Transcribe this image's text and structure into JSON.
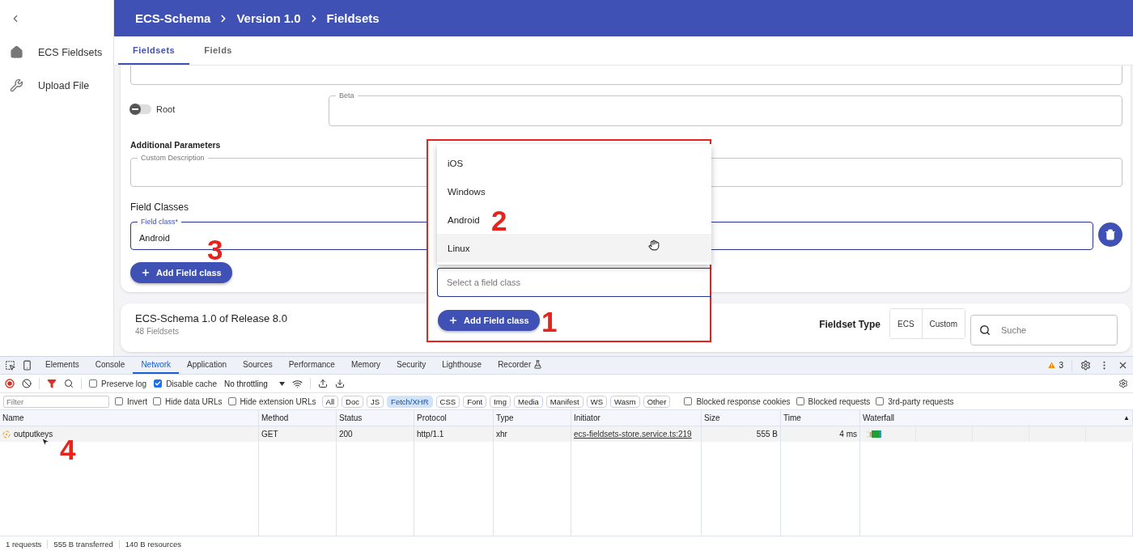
{
  "sidebar": {
    "items": [
      {
        "label": "ECS Fieldsets"
      },
      {
        "label": "Upload File"
      }
    ]
  },
  "breadcrumb": [
    "ECS-Schema",
    "Version 1.0",
    "Fieldsets"
  ],
  "tabs": [
    {
      "label": "Fieldsets",
      "selected": true
    },
    {
      "label": "Fields",
      "selected": false
    }
  ],
  "form": {
    "root_toggle": {
      "label": "Root",
      "on": false
    },
    "beta_field": {
      "label": "Beta"
    },
    "additional_parameters": "Additional Parameters",
    "custom_description": {
      "label": "Custom Description"
    },
    "field_classes_heading": "Field Classes",
    "field_class": {
      "label": "Field class*",
      "value": "Android"
    },
    "add_button": "Add Field class"
  },
  "fieldsets_card": {
    "title": "ECS-Schema 1.0 of Release 8.0",
    "count": "48 Fieldsets",
    "type_label": "Fieldset Type",
    "type_options": [
      {
        "label": "ECS",
        "selected": false
      },
      {
        "label": "Custom",
        "selected": false
      }
    ],
    "search": {
      "placeholder": "Suche"
    }
  },
  "overlay": {
    "options": [
      {
        "label": "iOS",
        "hovered": false
      },
      {
        "label": "Windows",
        "hovered": false
      },
      {
        "label": "Android",
        "hovered": false
      },
      {
        "label": "Linux",
        "hovered": true
      }
    ],
    "field": {
      "placeholder": "Select a field class"
    },
    "add_button": "Add Field class"
  },
  "annotations": [
    "1",
    "2",
    "3",
    "4"
  ],
  "devtools": {
    "panel_tabs": [
      {
        "label": "Elements",
        "selected": false
      },
      {
        "label": "Console",
        "selected": false
      },
      {
        "label": "Network",
        "selected": true
      },
      {
        "label": "Application",
        "selected": false
      },
      {
        "label": "Sources",
        "selected": false
      },
      {
        "label": "Performance",
        "selected": false
      },
      {
        "label": "Memory",
        "selected": false
      },
      {
        "label": "Security",
        "selected": false
      },
      {
        "label": "Lighthouse",
        "selected": false
      },
      {
        "label": "Recorder",
        "selected": false
      }
    ],
    "warnings": "3",
    "toolbar": {
      "checkboxes": [
        {
          "label": "Preserve log",
          "checked": false
        },
        {
          "label": "Disable cache",
          "checked": true
        }
      ],
      "throttling": "No throttling"
    },
    "filter": {
      "placeholder": "Filter",
      "checkboxes": [
        {
          "label": "Invert",
          "checked": false
        },
        {
          "label": "Hide data URLs",
          "checked": false
        },
        {
          "label": "Hide extension URLs",
          "checked": false
        }
      ],
      "types": [
        {
          "label": "All",
          "selected": false
        },
        {
          "label": "Doc",
          "selected": false
        },
        {
          "label": "JS",
          "selected": false
        },
        {
          "label": "Fetch/XHR",
          "selected": true
        },
        {
          "label": "CSS",
          "selected": false
        },
        {
          "label": "Font",
          "selected": false
        },
        {
          "label": "Img",
          "selected": false
        },
        {
          "label": "Media",
          "selected": false
        },
        {
          "label": "Manifest",
          "selected": false
        },
        {
          "label": "WS",
          "selected": false
        },
        {
          "label": "Wasm",
          "selected": false
        },
        {
          "label": "Other",
          "selected": false
        }
      ],
      "more_checkboxes": [
        {
          "label": "Blocked response cookies",
          "checked": false
        },
        {
          "label": "Blocked requests",
          "checked": false
        },
        {
          "label": "3rd-party requests",
          "checked": false
        }
      ]
    },
    "table": {
      "columns": [
        "Name",
        "Method",
        "Status",
        "Protocol",
        "Type",
        "Initiator",
        "Size",
        "Time",
        "Waterfall"
      ],
      "sort_indicator": "▲",
      "rows": [
        {
          "cells": [
            "outputkeys",
            "GET",
            "200",
            "http/1.1",
            "xhr",
            "ecs-fieldsets-store.service.ts:219",
            "555 B",
            "4 ms"
          ]
        }
      ]
    },
    "status_bar": [
      "1 requests",
      "555 B transferred",
      "140 B resources"
    ]
  }
}
